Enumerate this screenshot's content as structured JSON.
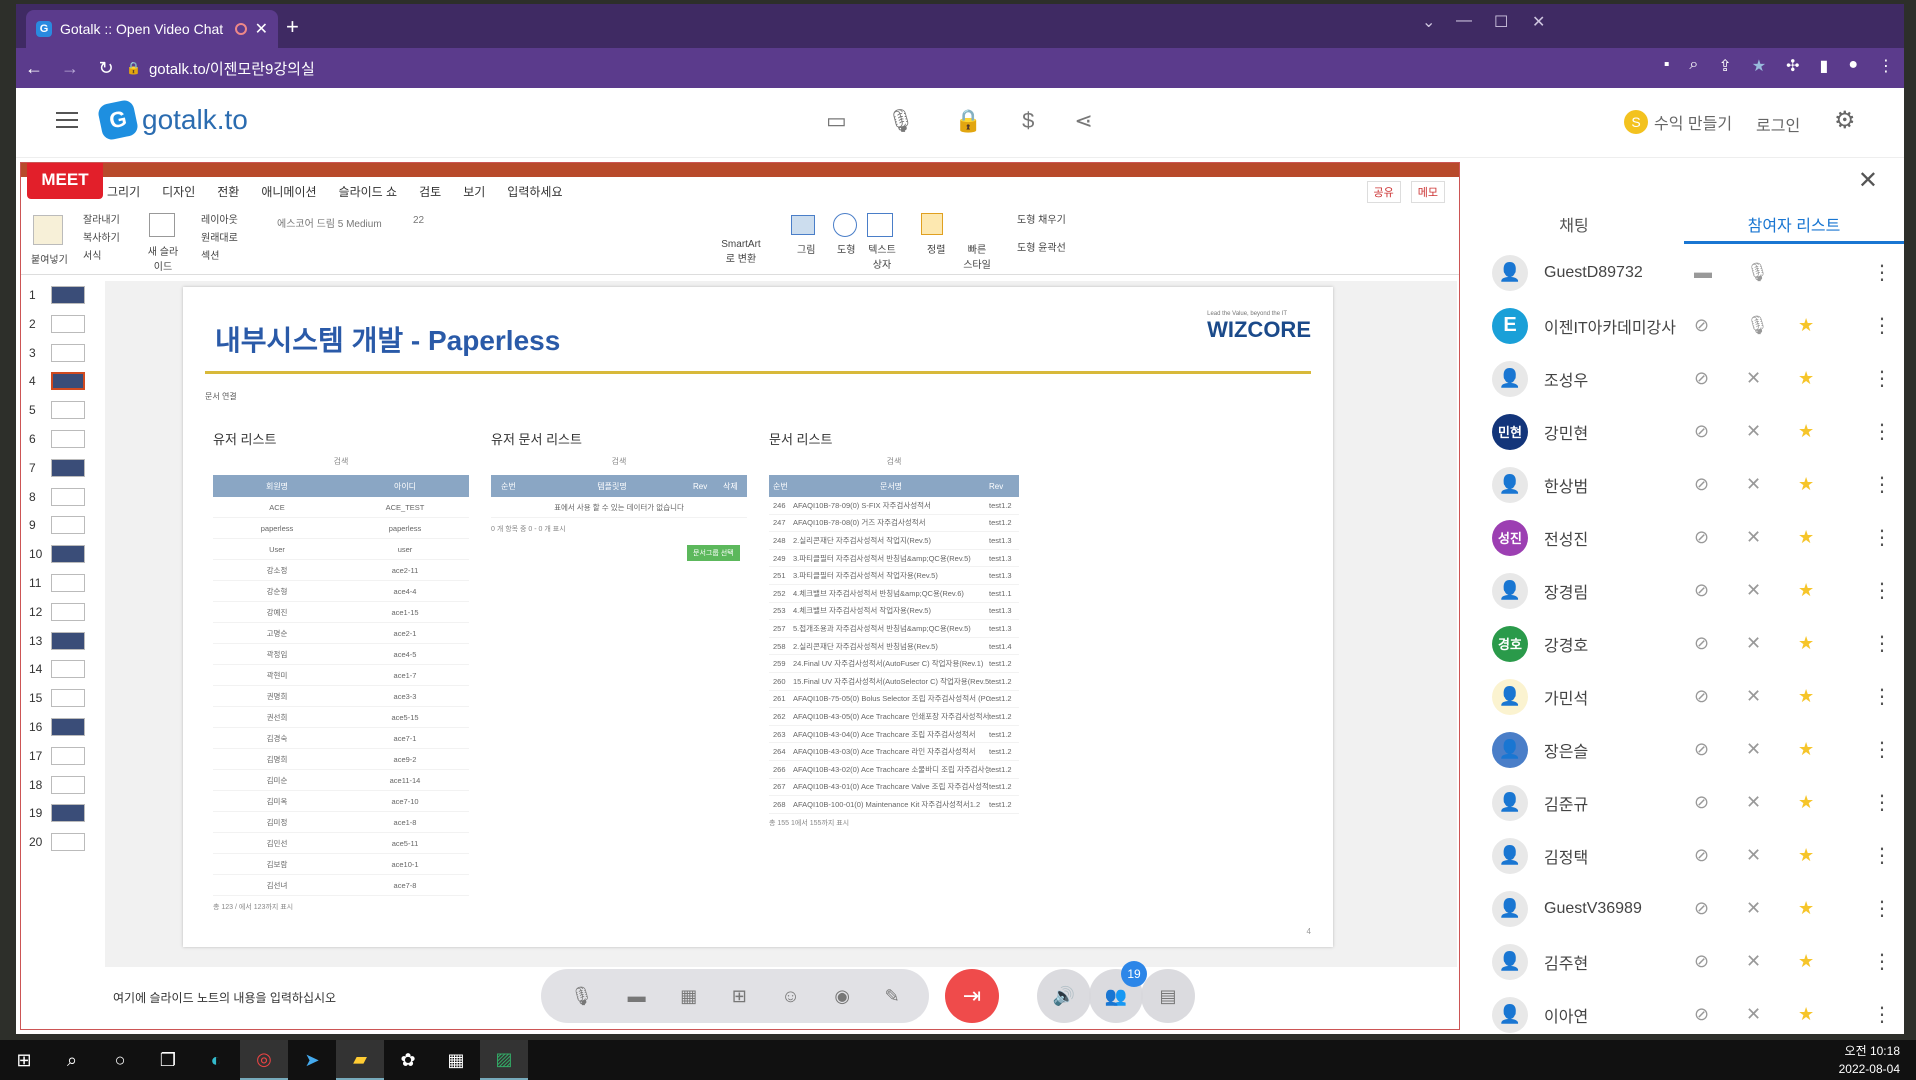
{
  "browser": {
    "tab_title": "Gotalk :: Open Video Chat",
    "url": "gotalk.to/이젠모란9강의실",
    "fav": "G",
    "close": "✕",
    "newtab": "+"
  },
  "app": {
    "logo": "gotalk.to",
    "logo_letter": "G",
    "earn": "수익 만들기",
    "login": "로그인",
    "coin": "S"
  },
  "meet_label": "MEET",
  "ppt": {
    "menu": [
      "그리기",
      "디자인",
      "전환",
      "애니메이션",
      "슬라이드 쇼",
      "검토",
      "보기",
      "입력하세요"
    ],
    "share": "공유",
    "memo": "메모",
    "ribbon": {
      "cut": "잘라내기",
      "copy": "복사하기",
      "format": "서식",
      "paste": "붙여넣기",
      "new_slide": "새 슬라이드",
      "layout": "레이아웃",
      "reset": "원래대로",
      "section": "섹션",
      "font": "에스코어 드림 5 Medium",
      "size": "22",
      "smartart": "SmartArt로 변환",
      "picture": "그림",
      "shape": "도형",
      "textbox": "텍스트 상자",
      "arrange": "정렬",
      "quick": "빠른 스타일",
      "fill": "도형 채우기",
      "outline": "도형 윤곽선"
    },
    "thumbs": [
      "1",
      "2",
      "3",
      "4",
      "5",
      "6",
      "7",
      "8",
      "9",
      "10",
      "11",
      "12",
      "13",
      "14",
      "15",
      "16",
      "17",
      "18",
      "19",
      "20"
    ],
    "note": "여기에 슬라이드 노트의 내용을 입력하십시오"
  },
  "slide": {
    "title": "내부시스템 개발 - Paperless",
    "brand": "WIZCORE",
    "brand_sub": "Lead the Value, beyond the IT",
    "crumb": "문서 연결",
    "page": "4",
    "users": {
      "title": "유저 리스트",
      "search": "검색",
      "cols": [
        "회원명",
        "아이디"
      ],
      "rows": [
        [
          "ACE",
          "ACE_TEST"
        ],
        [
          "paperless",
          "paperless"
        ],
        [
          "User",
          "user"
        ],
        [
          "강소정",
          "ace2-11"
        ],
        [
          "강순형",
          "ace4-4"
        ],
        [
          "강예진",
          "ace1-15"
        ],
        [
          "고명순",
          "ace2-1"
        ],
        [
          "곽정임",
          "ace4-5"
        ],
        [
          "곽현미",
          "ace1-7"
        ],
        [
          "권명희",
          "ace3-3"
        ],
        [
          "권선희",
          "ace5-15"
        ],
        [
          "김경숙",
          "ace7-1"
        ],
        [
          "김명희",
          "ace9-2"
        ],
        [
          "김미순",
          "ace11-14"
        ],
        [
          "김미옥",
          "ace7-10"
        ],
        [
          "김미정",
          "ace1-8"
        ],
        [
          "김민선",
          "ace5-11"
        ],
        [
          "김보람",
          "ace10-1"
        ],
        [
          "김선녀",
          "ace7-8"
        ]
      ],
      "footer": "총 123 / 에서 123까지 표시"
    },
    "udocs": {
      "title": "유저 문서 리스트",
      "search": "검색",
      "cols": [
        "순번",
        "템플릿명",
        "Rev",
        "삭제"
      ],
      "empty": "표에서 사용 할 수 있는 데이터가 없습니다",
      "count": "0 개 항목 중 0 - 0 개 표시",
      "btn": "문서그룹 선택"
    },
    "docs": {
      "title": "문서 리스트",
      "search": "검색",
      "cols": [
        "순번",
        "문서명",
        "Rev"
      ],
      "rows": [
        [
          "246",
          "AFAQI10B-78-09(0) S-FIX 자주검사성적서",
          "test1.2"
        ],
        [
          "247",
          "AFAQI10B-78-08(0) 거즈 자주검사성적서",
          "test1.2"
        ],
        [
          "248",
          "2.실리콘재단 자주검사성적서 작업지(Rev.5)",
          "test1.3"
        ],
        [
          "249",
          "3.파티클필터 자주검사성적서 반칭넘&amp;QC용(Rev.5)",
          "test1.3"
        ],
        [
          "251",
          "3.파티클필터 자주검사성적서 작업자용(Rev.5)",
          "test1.3"
        ],
        [
          "252",
          "4.체크밸브 자주검사성적서 반칭넘&amp;QC용(Rev.6)",
          "test1.1"
        ],
        [
          "253",
          "4.체크밸브 자주검사성적서 작업자용(Rev.5)",
          "test1.3"
        ],
        [
          "257",
          "5.접개조용과 자주검사성적서 반칭넘&amp;QC용(Rev.5)",
          "test1.3"
        ],
        [
          "258",
          "2.실리콘재단 자주검사성적서 반칭넘용(Rev.5)",
          "test1.4"
        ],
        [
          "259",
          "24.Final UV 자주검사성적서(AutoFuser C) 작업자용(Rev.1)",
          "test1.2"
        ],
        [
          "260",
          "15.Final UV 자주검사성적서(AutoSelector C) 작업자용(Rev.5)",
          "test1.2"
        ],
        [
          "261",
          "AFAQI10B-75-05(0) Bolus Selector 조립 자주검사성적서 (PCM3)",
          "test1.2"
        ],
        [
          "262",
          "AFAQI10B-43-05(0) Ace Trachcare 인쇄포장 자주검사성적서",
          "test1.2"
        ],
        [
          "263",
          "AFAQI10B-43-04(0) Ace Trachcare 조립 자주검사성적서",
          "test1.2"
        ],
        [
          "264",
          "AFAQI10B-43-03(0) Ace Trachcare 라인 자주검사성적서",
          "test1.2"
        ],
        [
          "266",
          "AFAQI10B-43-02(0) Ace Trachcare 소물바디 조립 자주검사성적서",
          "test1.2"
        ],
        [
          "267",
          "AFAQI10B-43-01(0) Ace Trachcare Valve 조립 자주검사성적서",
          "test1.2"
        ],
        [
          "268",
          "AFAQI10B-100-01(0) Maintenance Kit 자주검사성적서1.2",
          "test1.2"
        ]
      ],
      "footer": "총 155 1에서 155까지 표시"
    }
  },
  "sidebar": {
    "tab_chat": "채팅",
    "tab_participants": "참여자 리스트",
    "count": "19",
    "participants": [
      {
        "name": "GuestD89732",
        "avatar": "",
        "color": "#e8e8e8",
        "star": false,
        "video": true,
        "mic": true
      },
      {
        "name": "이젠IT아카데미강사",
        "avatar": "E",
        "color": "#1aa0d8",
        "star": true,
        "video": false,
        "mic": true
      },
      {
        "name": "조성우",
        "avatar": "",
        "color": "#e8e8e8",
        "star": true,
        "video": false,
        "mic": false
      },
      {
        "name": "강민현",
        "avatar": "민현",
        "color": "#13357a",
        "star": true,
        "video": false,
        "mic": false
      },
      {
        "name": "한상범",
        "avatar": "",
        "color": "#e8e8e8",
        "star": true,
        "video": false,
        "mic": false
      },
      {
        "name": "전성진",
        "avatar": "성진",
        "color": "#9c3fb2",
        "star": true,
        "video": false,
        "mic": false
      },
      {
        "name": "장경림",
        "avatar": "",
        "color": "#e8e8e8",
        "star": true,
        "video": false,
        "mic": false
      },
      {
        "name": "강경호",
        "avatar": "경호",
        "color": "#2a9a4a",
        "star": true,
        "video": false,
        "mic": false
      },
      {
        "name": "가민석",
        "avatar": "",
        "color": "#fbf3d0",
        "star": true,
        "video": false,
        "mic": false
      },
      {
        "name": "장은슬",
        "avatar": "",
        "color": "#4a7ec8",
        "star": true,
        "video": false,
        "mic": false
      },
      {
        "name": "김준규",
        "avatar": "",
        "color": "#e8e8e8",
        "star": true,
        "video": false,
        "mic": false
      },
      {
        "name": "김정택",
        "avatar": "",
        "color": "#e8e8e8",
        "star": true,
        "video": false,
        "mic": false
      },
      {
        "name": "GuestV36989",
        "avatar": "",
        "color": "#e8e8e8",
        "star": true,
        "video": false,
        "mic": false
      },
      {
        "name": "김주현",
        "avatar": "",
        "color": "#e8e8e8",
        "star": true,
        "video": false,
        "mic": false
      },
      {
        "name": "이아연",
        "avatar": "",
        "color": "#e8e8e8",
        "star": true,
        "video": false,
        "mic": false
      }
    ]
  },
  "taskbar": {
    "time": "오전 10:18",
    "date": "2022-08-04"
  }
}
